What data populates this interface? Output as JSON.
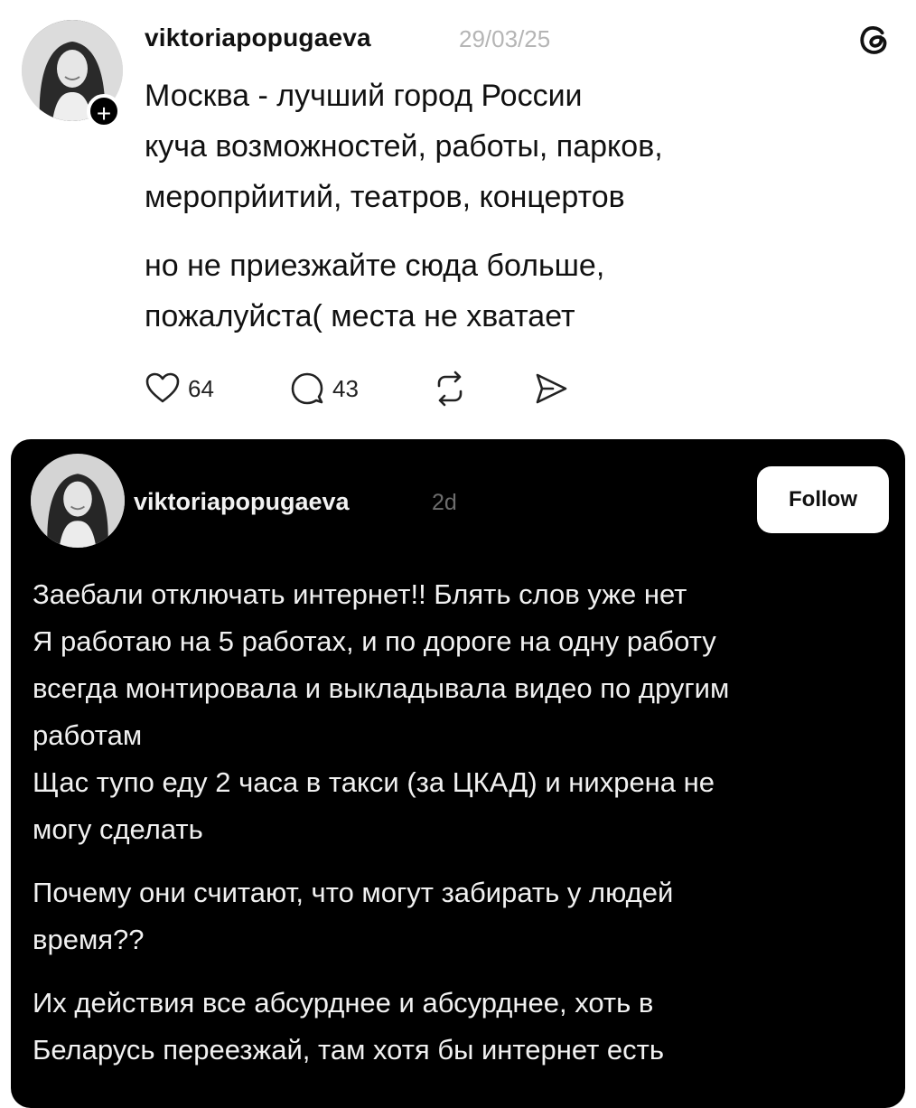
{
  "post1": {
    "username": "viktoriapopugaeva",
    "date": "29/03/25",
    "avatar_icon": "profile-photo",
    "follow_icon": "plus-icon",
    "brand_icon": "threads-logo-icon",
    "paragraphs": [
      [
        "Москва - лучший город России",
        "куча возможностей, работы, парков,",
        "меропрйитий, театров, концертов"
      ],
      [
        "но не приезжайте сюда больше,",
        "пожалуйста( места не хватает"
      ]
    ],
    "likes": "64",
    "comments": "43",
    "icons": [
      "heart-icon",
      "comment-icon",
      "repost-icon",
      "share-icon"
    ]
  },
  "post2": {
    "username": "viktoriapopugaeva",
    "time": "2d",
    "follow_label": "Follow",
    "paragraphs": [
      [
        "Заебали отключать интернет!! Блять слов уже нет",
        "Я работаю на 5 работах, и по дороге на одну работу",
        "всегда монтировала и выкладывала видео по другим",
        "работам",
        "Щас тупо еду 2 часа в такси (за ЦКАД) и нихрена не",
        "могу сделать"
      ],
      [
        "Почему они считают, что могут забирать у людей",
        "время??"
      ],
      [
        "Их действия все абсурднее и абсурднее, хоть в",
        "Беларусь переезжай, там хотя бы интернет есть"
      ]
    ]
  },
  "colors": {
    "light_bg": "#ffffff",
    "dark_bg": "#000000",
    "muted_text": "#b5b5b5",
    "follow_button": "#ffffff"
  }
}
